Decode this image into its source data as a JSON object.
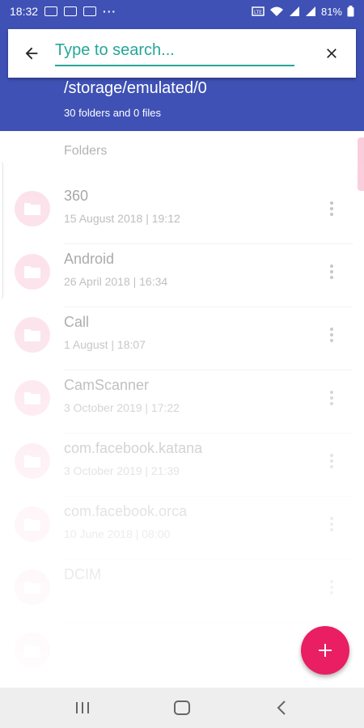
{
  "status_bar": {
    "time": "18:32",
    "more": "···",
    "battery": "81%"
  },
  "search": {
    "placeholder": "Type to search...",
    "back_icon": "arrow-back-icon",
    "clear_icon": "close-icon"
  },
  "header": {
    "path": "/storage/emulated/0",
    "count": "30 folders and 0 files"
  },
  "list": {
    "section_label": "Folders",
    "items": [
      {
        "name": "360",
        "date": "15 August 2018 | 19:12"
      },
      {
        "name": "Android",
        "date": "26 April 2018 | 16:34"
      },
      {
        "name": "Call",
        "date": "1 August | 18:07"
      },
      {
        "name": "CamScanner",
        "date": "3 October 2019 | 17:22"
      },
      {
        "name": "com.facebook.katana",
        "date": "3 October 2019 | 21:39"
      },
      {
        "name": "com.facebook.orca",
        "date": "10 June 2018 | 08:00"
      },
      {
        "name": "DCIM",
        "date": ""
      },
      {
        "name": "",
        "date": ""
      }
    ]
  },
  "fab": {
    "icon": "plus-icon"
  },
  "colors": {
    "primary": "#3f51b5",
    "accent": "#e91e63",
    "folder_bg": "#f8bbd0",
    "search_accent": "#26a69a"
  }
}
